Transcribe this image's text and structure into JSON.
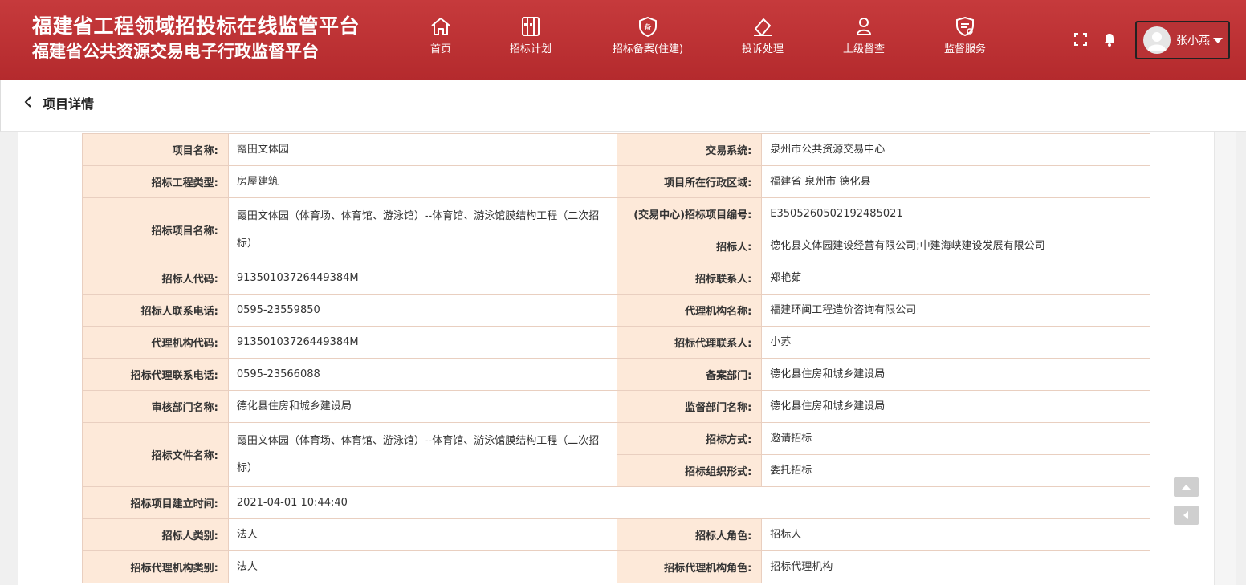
{
  "header": {
    "title_line1": "福建省工程领域招投标在线监管平台",
    "title_line2": "福建省公共资源交易电子行政监督平台",
    "nav": [
      {
        "label": "首页",
        "icon": "home-icon"
      },
      {
        "label": "招标计划",
        "icon": "plan-icon"
      },
      {
        "label": "招标备案(住建)",
        "icon": "record-shield-icon"
      },
      {
        "label": "投诉处理",
        "icon": "complaint-icon"
      },
      {
        "label": "上级督查",
        "icon": "inspector-icon"
      },
      {
        "label": "监督服务",
        "icon": "supervision-service-icon"
      }
    ],
    "user_name": "张小燕"
  },
  "page": {
    "title": "项目详情"
  },
  "fields": {
    "project_name_label": "项目名称:",
    "project_name": "霞田文体园",
    "trade_system_label": "交易系统:",
    "trade_system": "泉州市公共资源交易中心",
    "bid_type_label": "招标工程类型:",
    "bid_type": "房屋建筑",
    "region_label": "项目所在行政区域:",
    "region": "福建省 泉州市 德化县",
    "bid_project_name_label": "招标项目名称:",
    "bid_project_name": "霞田文体园（体育场、体育馆、游泳馆）--体育馆、游泳馆膜结构工程（二次招标）",
    "bid_project_no_label": "(交易中心)招标项目编号:",
    "bid_project_no": "E3505260502192485021",
    "tenderer_label": "招标人:",
    "tenderer": "德化县文体园建设经营有限公司;中建海峡建设发展有限公司",
    "tenderer_code_label": "招标人代码:",
    "tenderer_code": "91350103726449384M",
    "tender_contact_label": "招标联系人:",
    "tender_contact": "郑艳茹",
    "tenderer_phone_label": "招标人联系电话:",
    "tenderer_phone": "0595-23559850",
    "agency_name_label": "代理机构名称:",
    "agency_name": "福建环闽工程造价咨询有限公司",
    "agency_code_label": "代理机构代码:",
    "agency_code": "91350103726449384M",
    "agency_contact_label": "招标代理联系人:",
    "agency_contact": "小苏",
    "agency_phone_label": "招标代理联系电话:",
    "agency_phone": "0595-23566088",
    "record_dept_label": "备案部门:",
    "record_dept": "德化县住房和城乡建设局",
    "audit_dept_label": "审核部门名称:",
    "audit_dept": "德化县住房和城乡建设局",
    "supervise_dept_label": "监督部门名称:",
    "supervise_dept": "德化县住房和城乡建设局",
    "bid_doc_name_label": "招标文件名称:",
    "bid_doc_name": "霞田文体园（体育场、体育馆、游泳馆）--体育馆、游泳馆膜结构工程（二次招标）",
    "bid_method_label": "招标方式:",
    "bid_method": "邀请招标",
    "bid_org_label": "招标组织形式:",
    "bid_org": "委托招标",
    "created_label": "招标项目建立时间:",
    "created": "2021-04-01 10:44:40",
    "tenderer_type_label": "招标人类别:",
    "tenderer_type": "法人",
    "tenderer_role_label": "招标人角色:",
    "tenderer_role": "招标人",
    "agency_type_label": "招标代理机构类别:",
    "agency_type": "法人",
    "agency_role_label": "招标代理机构角色:",
    "agency_role": "招标代理机构"
  },
  "colors": {
    "header_red": "#b42a2d",
    "label_bg": "#fde9d9",
    "border": "#e9cfc0"
  }
}
